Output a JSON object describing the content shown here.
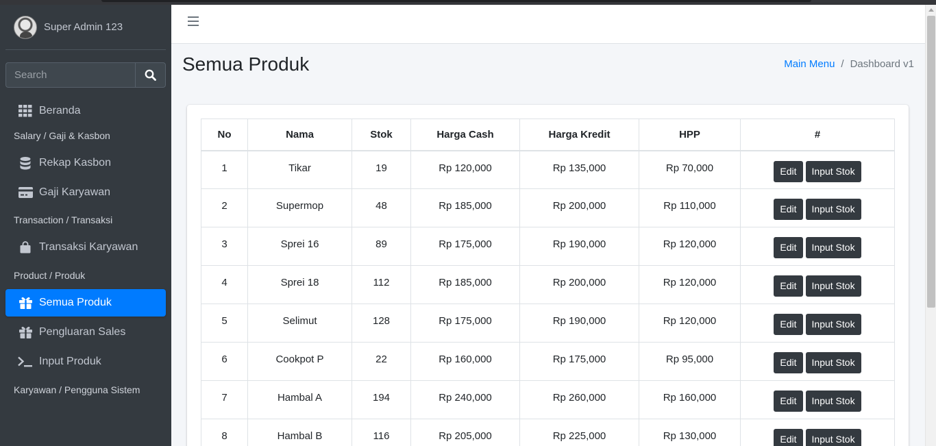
{
  "sidebar": {
    "user_name": "Super Admin 123",
    "search_placeholder": "Search",
    "items": [
      {
        "type": "item",
        "label": "Beranda",
        "icon": "grid-icon",
        "active": false
      },
      {
        "type": "header",
        "label": "Salary / Gaji & Kasbon"
      },
      {
        "type": "item",
        "label": "Rekap Kasbon",
        "icon": "database-icon",
        "active": false
      },
      {
        "type": "item",
        "label": "Gaji Karyawan",
        "icon": "credit-card-icon",
        "active": false
      },
      {
        "type": "header",
        "label": "Transaction / Transaksi"
      },
      {
        "type": "item",
        "label": "Transaksi Karyawan",
        "icon": "shopping-bag-icon",
        "active": false
      },
      {
        "type": "header",
        "label": "Product / Produk"
      },
      {
        "type": "item",
        "label": "Semua Produk",
        "icon": "gift-icon",
        "active": true
      },
      {
        "type": "item",
        "label": "Pengluaran Sales",
        "icon": "gift-icon",
        "active": false
      },
      {
        "type": "item",
        "label": "Input Produk",
        "icon": "terminal-icon",
        "active": false
      },
      {
        "type": "header",
        "label": "Karyawan / Pengguna Sistem"
      }
    ]
  },
  "header": {
    "page_title": "Semua Produk",
    "breadcrumb": {
      "link": "Main Menu",
      "separator": "/",
      "current": "Dashboard v1"
    }
  },
  "table": {
    "columns": [
      "No",
      "Nama",
      "Stok",
      "Harga Cash",
      "Harga Kredit",
      "HPP",
      "#"
    ],
    "edit_label": "Edit",
    "input_stok_label": "Input Stok",
    "rows": [
      [
        "1",
        "Tikar",
        "19",
        "Rp 120,000",
        "Rp 135,000",
        "Rp 70,000"
      ],
      [
        "2",
        "Supermop",
        "48",
        "Rp 185,000",
        "Rp 200,000",
        "Rp 110,000"
      ],
      [
        "3",
        "Sprei 16",
        "89",
        "Rp 175,000",
        "Rp 190,000",
        "Rp 120,000"
      ],
      [
        "4",
        "Sprei 18",
        "112",
        "Rp 185,000",
        "Rp 200,000",
        "Rp 120,000"
      ],
      [
        "5",
        "Selimut",
        "128",
        "Rp 175,000",
        "Rp 190,000",
        "Rp 120,000"
      ],
      [
        "6",
        "Cookpot P",
        "22",
        "Rp 160,000",
        "Rp 175,000",
        "Rp 95,000"
      ],
      [
        "7",
        "Hambal A",
        "194",
        "Rp 240,000",
        "Rp 260,000",
        "Rp 160,000"
      ],
      [
        "8",
        "Hambal B",
        "116",
        "Rp 205,000",
        "Rp 225,000",
        "Rp 130,000"
      ]
    ]
  },
  "colors": {
    "sidebar_bg": "#343a40",
    "active": "#007bff",
    "button": "#343a40",
    "link": "#007bff"
  }
}
